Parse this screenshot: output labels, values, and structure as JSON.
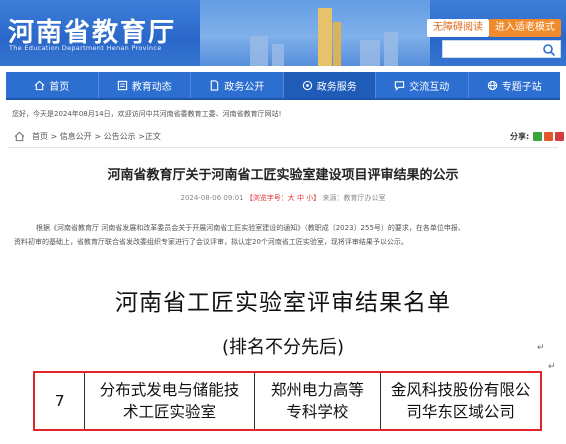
{
  "header": {
    "title": "河南省教育厅",
    "subtitle": "The Education Department Henan Province",
    "accessibility_btn": "无障碍阅读",
    "elder_btn": "进入适老模式"
  },
  "nav": {
    "items": [
      {
        "label": "首页",
        "icon": "home-icon"
      },
      {
        "label": "教育动态",
        "icon": "news-icon"
      },
      {
        "label": "政务公开",
        "icon": "document-icon"
      },
      {
        "label": "政务服务",
        "icon": "service-icon"
      },
      {
        "label": "交流互动",
        "icon": "chat-icon"
      },
      {
        "label": "专题子站",
        "icon": "site-icon"
      }
    ]
  },
  "notice": "您好，今天是2024年08月14日，欢迎访问中共河南省委教育工委、河南省教育厅网站!",
  "breadcrumb": "首页 > 信息公开 > 公告公示 >正文",
  "share_label": "分享:",
  "article": {
    "title": "河南省教育厅关于河南省工匠实验室建设项目评审结果的公示",
    "date": "2024-08-06 09:01",
    "font_size_label": "【浏览字号：大 中 小】",
    "source": "来源：教育厅办公室",
    "para1": "根据《河南省教育厅 河南省发展和改革委员会关于开展河南省工匠实验室建设的通知》（教职成〔2023〕255号）的要求，在各单位申报、",
    "para2": "资料初审的基础上，省教育厅联合省发改委组织专家进行了会议评审，拟认定20个河南省工匠实验室，现将评审结果予以公示。"
  },
  "doc": {
    "title": "河南省工匠实验室评审结果名单",
    "subtitle": "(排名不分先后)",
    "row": {
      "no": "7",
      "lab_line1": "分布式发电与储能技",
      "lab_line2": "术工匠实验室",
      "school_line1": "郑州电力高等",
      "school_line2": "专科学校",
      "company_line1": "金风科技股份有限公",
      "company_line2": "司华东区域公司"
    },
    "return_mark": "↵"
  },
  "colors": {
    "nav_bg": "#2c6fd0",
    "highlight_border": "#e0262b",
    "elder_btn": "#f08a2a"
  }
}
